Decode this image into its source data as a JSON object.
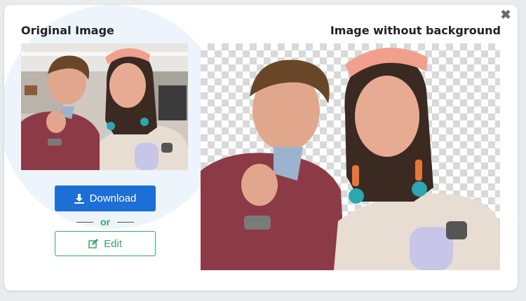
{
  "dialog": {
    "close_icon": "close-icon",
    "original_title": "Original Image",
    "result_title": "Image without background"
  },
  "actions": {
    "download_label": "Download",
    "download_icon": "download-icon",
    "or_label": "or",
    "edit_label": "Edit",
    "edit_icon": "edit-icon"
  },
  "colors": {
    "primary": "#1c6fd6",
    "success": "#3aa66a",
    "accent_bg": "#eef4fb"
  }
}
